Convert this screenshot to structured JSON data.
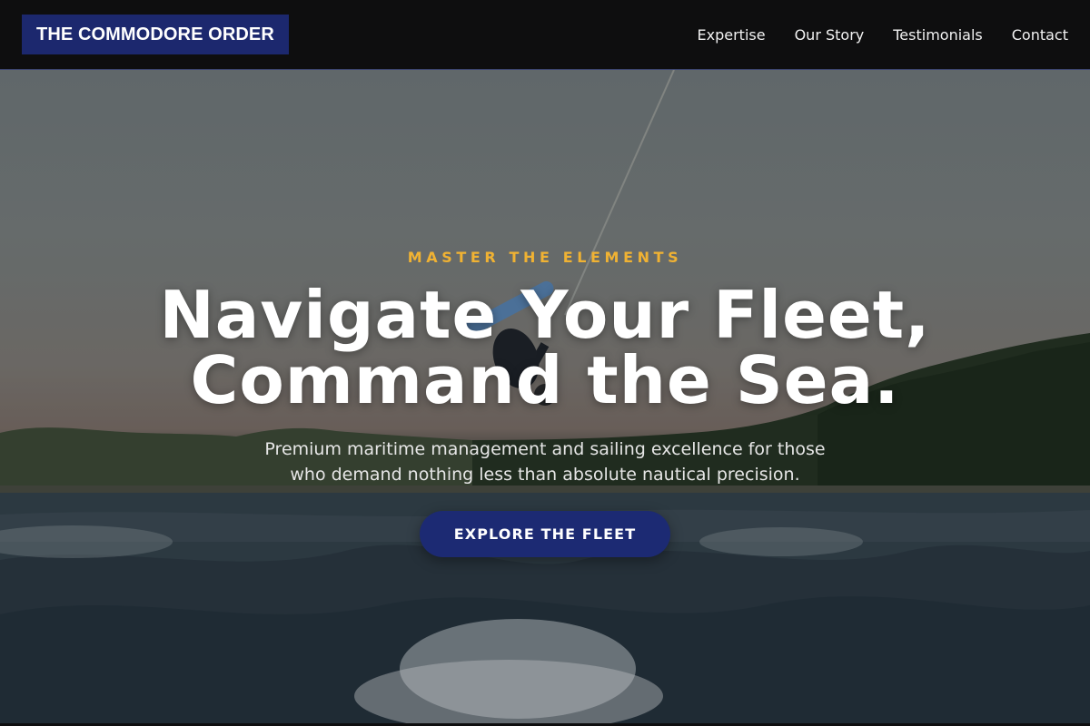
{
  "brand": {
    "name": "THE COMMODORE ORDER"
  },
  "nav": {
    "items": [
      {
        "label": "Expertise"
      },
      {
        "label": "Our Story"
      },
      {
        "label": "Testimonials"
      },
      {
        "label": "Contact"
      }
    ]
  },
  "hero": {
    "eyebrow": "MASTER THE ELEMENTS",
    "headline_line1": "Navigate Your Fleet,",
    "headline_line2": "Command the Sea.",
    "subtitle_line1": "Premium maritime management and sailing excellence for those",
    "subtitle_line2": "who demand nothing less than absolute nautical precision.",
    "cta_label": "EXPLORE THE FLEET",
    "image_subject": "wakeboarder flipping above boat wake on a lake"
  },
  "colors": {
    "brand_bg": "#1c286e",
    "accent_gold": "#f0b233",
    "cta_bg": "#1c2a73",
    "header_bg": "#0e0e0f"
  }
}
